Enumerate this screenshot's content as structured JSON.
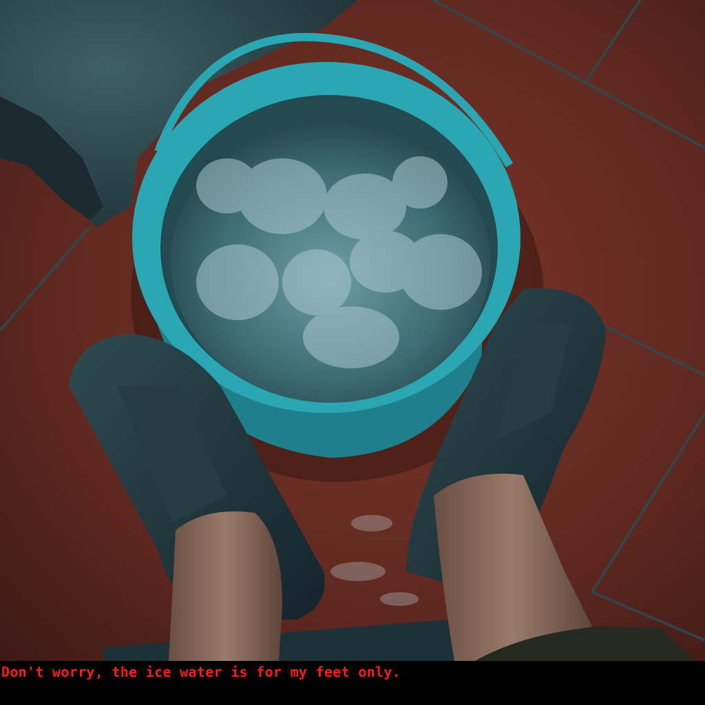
{
  "caption": {
    "text": "Don't worry, the ice water is for my feet only.",
    "color": "#ff1a1a"
  },
  "scene": {
    "subjects": [
      "bucket-of-ice-water",
      "feet-in-slippers",
      "tiled-floor",
      "stone-block"
    ],
    "colors": {
      "floor": "#6e2e24",
      "grout": "#2e4a4e",
      "bucket": "#2aa7b3",
      "water": "#3d6f78",
      "slippers": "#1f3036",
      "skin": "#8a6a5a"
    }
  }
}
